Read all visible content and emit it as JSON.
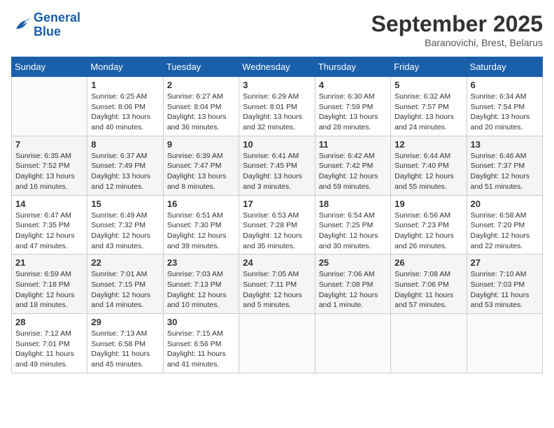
{
  "header": {
    "logo_line1": "General",
    "logo_line2": "Blue",
    "month": "September 2025",
    "location": "Baranovichi, Brest, Belarus"
  },
  "weekdays": [
    "Sunday",
    "Monday",
    "Tuesday",
    "Wednesday",
    "Thursday",
    "Friday",
    "Saturday"
  ],
  "weeks": [
    [
      {
        "day": "",
        "info": ""
      },
      {
        "day": "1",
        "info": "Sunrise: 6:25 AM\nSunset: 8:06 PM\nDaylight: 13 hours\nand 40 minutes."
      },
      {
        "day": "2",
        "info": "Sunrise: 6:27 AM\nSunset: 8:04 PM\nDaylight: 13 hours\nand 36 minutes."
      },
      {
        "day": "3",
        "info": "Sunrise: 6:29 AM\nSunset: 8:01 PM\nDaylight: 13 hours\nand 32 minutes."
      },
      {
        "day": "4",
        "info": "Sunrise: 6:30 AM\nSunset: 7:59 PM\nDaylight: 13 hours\nand 28 minutes."
      },
      {
        "day": "5",
        "info": "Sunrise: 6:32 AM\nSunset: 7:57 PM\nDaylight: 13 hours\nand 24 minutes."
      },
      {
        "day": "6",
        "info": "Sunrise: 6:34 AM\nSunset: 7:54 PM\nDaylight: 13 hours\nand 20 minutes."
      }
    ],
    [
      {
        "day": "7",
        "info": "Sunrise: 6:35 AM\nSunset: 7:52 PM\nDaylight: 13 hours\nand 16 minutes."
      },
      {
        "day": "8",
        "info": "Sunrise: 6:37 AM\nSunset: 7:49 PM\nDaylight: 13 hours\nand 12 minutes."
      },
      {
        "day": "9",
        "info": "Sunrise: 6:39 AM\nSunset: 7:47 PM\nDaylight: 13 hours\nand 8 minutes."
      },
      {
        "day": "10",
        "info": "Sunrise: 6:41 AM\nSunset: 7:45 PM\nDaylight: 13 hours\nand 3 minutes."
      },
      {
        "day": "11",
        "info": "Sunrise: 6:42 AM\nSunset: 7:42 PM\nDaylight: 12 hours\nand 59 minutes."
      },
      {
        "day": "12",
        "info": "Sunrise: 6:44 AM\nSunset: 7:40 PM\nDaylight: 12 hours\nand 55 minutes."
      },
      {
        "day": "13",
        "info": "Sunrise: 6:46 AM\nSunset: 7:37 PM\nDaylight: 12 hours\nand 51 minutes."
      }
    ],
    [
      {
        "day": "14",
        "info": "Sunrise: 6:47 AM\nSunset: 7:35 PM\nDaylight: 12 hours\nand 47 minutes."
      },
      {
        "day": "15",
        "info": "Sunrise: 6:49 AM\nSunset: 7:32 PM\nDaylight: 12 hours\nand 43 minutes."
      },
      {
        "day": "16",
        "info": "Sunrise: 6:51 AM\nSunset: 7:30 PM\nDaylight: 12 hours\nand 39 minutes."
      },
      {
        "day": "17",
        "info": "Sunrise: 6:53 AM\nSunset: 7:28 PM\nDaylight: 12 hours\nand 35 minutes."
      },
      {
        "day": "18",
        "info": "Sunrise: 6:54 AM\nSunset: 7:25 PM\nDaylight: 12 hours\nand 30 minutes."
      },
      {
        "day": "19",
        "info": "Sunrise: 6:56 AM\nSunset: 7:23 PM\nDaylight: 12 hours\nand 26 minutes."
      },
      {
        "day": "20",
        "info": "Sunrise: 6:58 AM\nSunset: 7:20 PM\nDaylight: 12 hours\nand 22 minutes."
      }
    ],
    [
      {
        "day": "21",
        "info": "Sunrise: 6:59 AM\nSunset: 7:18 PM\nDaylight: 12 hours\nand 18 minutes."
      },
      {
        "day": "22",
        "info": "Sunrise: 7:01 AM\nSunset: 7:15 PM\nDaylight: 12 hours\nand 14 minutes."
      },
      {
        "day": "23",
        "info": "Sunrise: 7:03 AM\nSunset: 7:13 PM\nDaylight: 12 hours\nand 10 minutes."
      },
      {
        "day": "24",
        "info": "Sunrise: 7:05 AM\nSunset: 7:11 PM\nDaylight: 12 hours\nand 5 minutes."
      },
      {
        "day": "25",
        "info": "Sunrise: 7:06 AM\nSunset: 7:08 PM\nDaylight: 12 hours\nand 1 minute."
      },
      {
        "day": "26",
        "info": "Sunrise: 7:08 AM\nSunset: 7:06 PM\nDaylight: 11 hours\nand 57 minutes."
      },
      {
        "day": "27",
        "info": "Sunrise: 7:10 AM\nSunset: 7:03 PM\nDaylight: 11 hours\nand 53 minutes."
      }
    ],
    [
      {
        "day": "28",
        "info": "Sunrise: 7:12 AM\nSunset: 7:01 PM\nDaylight: 11 hours\nand 49 minutes."
      },
      {
        "day": "29",
        "info": "Sunrise: 7:13 AM\nSunset: 6:58 PM\nDaylight: 11 hours\nand 45 minutes."
      },
      {
        "day": "30",
        "info": "Sunrise: 7:15 AM\nSunset: 6:56 PM\nDaylight: 11 hours\nand 41 minutes."
      },
      {
        "day": "",
        "info": ""
      },
      {
        "day": "",
        "info": ""
      },
      {
        "day": "",
        "info": ""
      },
      {
        "day": "",
        "info": ""
      }
    ]
  ]
}
